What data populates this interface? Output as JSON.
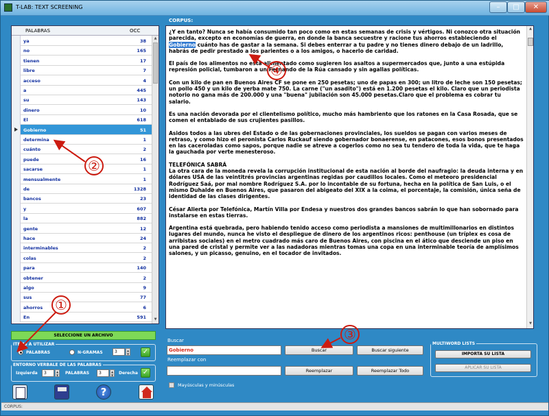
{
  "window": {
    "title": "T-LAB: TEXT SCREENING"
  },
  "word_list": {
    "headers": {
      "word": "PALABRAS",
      "occ": "OCC"
    },
    "rows": [
      {
        "word": "ya",
        "occ": "38"
      },
      {
        "word": "no",
        "occ": "165"
      },
      {
        "word": "tienen",
        "occ": "17"
      },
      {
        "word": "libre",
        "occ": "7"
      },
      {
        "word": "acceso",
        "occ": "4"
      },
      {
        "word": "a",
        "occ": "445"
      },
      {
        "word": "su",
        "occ": "143"
      },
      {
        "word": "dinero",
        "occ": "10"
      },
      {
        "word": "El",
        "occ": "618"
      },
      {
        "word": "Gobierno",
        "occ": "51",
        "selected": true
      },
      {
        "word": "determina",
        "occ": "1"
      },
      {
        "word": "cuánto",
        "occ": "2"
      },
      {
        "word": "puede",
        "occ": "16"
      },
      {
        "word": "sacarse",
        "occ": "1"
      },
      {
        "word": "mensualmente",
        "occ": "1"
      },
      {
        "word": "de",
        "occ": "1328"
      },
      {
        "word": "bancos",
        "occ": "23"
      },
      {
        "word": "y",
        "occ": "607"
      },
      {
        "word": "la",
        "occ": "882"
      },
      {
        "word": "gente",
        "occ": "12"
      },
      {
        "word": "hace",
        "occ": "24"
      },
      {
        "word": "interminables",
        "occ": "2"
      },
      {
        "word": "colas",
        "occ": "2"
      },
      {
        "word": "para",
        "occ": "140"
      },
      {
        "word": "obtener",
        "occ": "2"
      },
      {
        "word": "algo",
        "occ": "9"
      },
      {
        "word": "sus",
        "occ": "77"
      },
      {
        "word": "ahorros",
        "occ": "6"
      },
      {
        "word": "En",
        "occ": "591"
      }
    ]
  },
  "select_archive_label": "SELECCIONE UN ARCHIVO",
  "items_group": {
    "legend": "ITEMS A UTILIZAR",
    "palabras": "PALABRAS",
    "ngramas": "N-GRAMAS",
    "n_value": "3"
  },
  "entorno_group": {
    "legend": "ENTORNO VERBALE DE LAS PALABRAS",
    "izquierda": "Izquierda",
    "izq_value": "3",
    "palabras": "PALABRAS",
    "der_value": "3",
    "derecha": "Derecha"
  },
  "status_text": "CORPUS:",
  "corpus": {
    "label": "CORPUS:",
    "p1_before": "¿Y en tanto? Nunca se había consumido tan poco como en estas semanas de crisis y vértigos. Ni conozco otra situación parecida, excepto en economías de guerra, en donde la banca secuestre y racione tus ahorros estableciendo el ",
    "p1_highlight": "Gobierno",
    "p1_after": " cuánto has de gastar a la semana. Si debes enterrar a tu padre y no tienes dinero debajo de un ladrillo, habrás de pedir prestado a los parientes o a los amigos, o hacerlo de caridad.",
    "paragraphs": [
      "El país de los alimentos no está alimentado como sugieren los asaltos a supermercados que, junto a una estúpida represión policial, tumbaron a un Fernando de la Rúa cansado y sin agallas políticas.",
      "Con un kilo de pan en Buenos Aires CF se pone en 250 pesetas; uno de papas en 300; un litro de leche son 150 pesetas; un pollo 450 y un kilo de yerba mate 750. La carne (\"un asadito\") está en 1.200 pesetas el kilo. Claro que un periodista notorio no gana más de 200.000 y una \"buena\" jubilación son 45.000 pesetas.Claro que el problema es cobrar tu salario.",
      "Es una nación devorada por el clientelismo político, mucho más hambriento que los ratones en la Casa Rosada, que se comen el entablado de sus crujientes pasillos.",
      "Asidos todos a las ubres del Estado o de las gobernaciones provinciales, los sueldos se pagan con varios meses de retraso, y como hizo el peronista Carlos Ruckauf siendo gobernador bonaerense, en patacones, esos bonos presentados en las caceroladas como sapos, porque nadie se atreve a cogerlos como no sea tu tendero de toda la vida, que te haga la gauchada por verte menesteroso.",
      "TELEFÓNICA SABRÁ\nLa otra cara de la moneda revela la corrupción institucional de esta nación al borde del naufragio: la deuda interna y en dólares USA de las veintitrés provincias argentinas regidas por caudillos locales. Como el meteoro presidencial Rodríguez Saá, por mal nombre Rodríguez S.A. por lo incontable de su fortuna, hecha en la política de San Luis, o el mismo Duhalde en Buenos Aires, que pasaron del abigeato del XIX a la coima, el porcentaje, la comisión, única seña de identidad de las clases dirigentes.",
      "César Alierta por Telefónica, Martín Villa por Endesa y nuestros dos grandes bancos sabrán lo que han sobornado para instalarse en estas tierras.",
      "Argentina está quebrada, pero habiendo tenido acceso como periodista a mansiones de multimillonarios en distintos lugares del mundo, nunca he visto el despliegue de dinero de los argentinos ricos: penthouse (un tríplex es cosa de arribistas sociales) en el metro cuadrado más caro de Buenos Aires, con piscina en el ático que desciende un piso en una pared de cristal y permite ver a las nadadoras mientras tomas una copa en una interminable teoría de amplísimos salones, y un picasso, genuino, en el tocador de invitados."
    ]
  },
  "search": {
    "label": "Buscar",
    "value": "Gobierno",
    "button": "Buscar",
    "next_button": "Buscar siguiente"
  },
  "replace": {
    "label": "Reemplazar con",
    "value": "",
    "button": "Reemplazar",
    "all_button": "Reemplazar Todo"
  },
  "case_label": "Mayúsculas y minúsculas",
  "multiword": {
    "legend": "MULTIWORD LISTS",
    "import_button": "IMPORTA SU LISTA",
    "apply_button": "APLICAR SU LISTA"
  },
  "annotations": [
    "①",
    "②",
    "③",
    "④"
  ],
  "colors": {
    "window_bg": "#2f89c5",
    "selection": "#3296d8",
    "green_button": "#7ed957",
    "annotation": "#cc1b10"
  }
}
